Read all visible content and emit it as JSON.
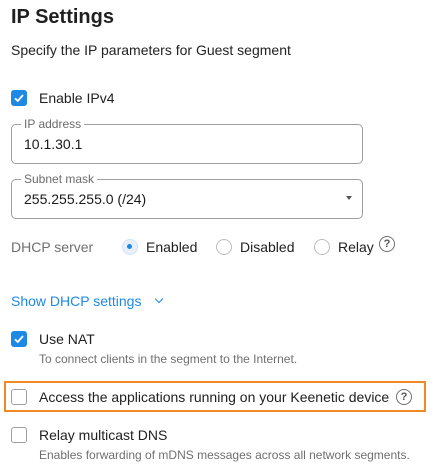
{
  "page": {
    "title": "IP Settings",
    "subtitle": "Specify the IP parameters for Guest segment"
  },
  "ipv4": {
    "label": "Enable IPv4",
    "checked": true
  },
  "ip_address": {
    "label": "IP address",
    "value": "10.1.30.1"
  },
  "subnet_mask": {
    "label": "Subnet mask",
    "value": "255.255.255.0 (/24)"
  },
  "dhcp": {
    "label": "DHCP server",
    "options": [
      "Enabled",
      "Disabled",
      "Relay"
    ],
    "selected": "Enabled"
  },
  "dhcp_settings_link": "Show DHCP settings",
  "nat": {
    "label": "Use NAT",
    "help": "To connect clients in the segment to the Internet.",
    "checked": true
  },
  "apps_access": {
    "label": "Access the applications running on your Keenetic device",
    "checked": false
  },
  "mdns": {
    "label": "Relay multicast DNS",
    "help": "Enables forwarding of mDNS messages across all network segments.",
    "checked": false
  },
  "colors": {
    "accent": "#1e88e5",
    "highlight": "#f08a24"
  }
}
